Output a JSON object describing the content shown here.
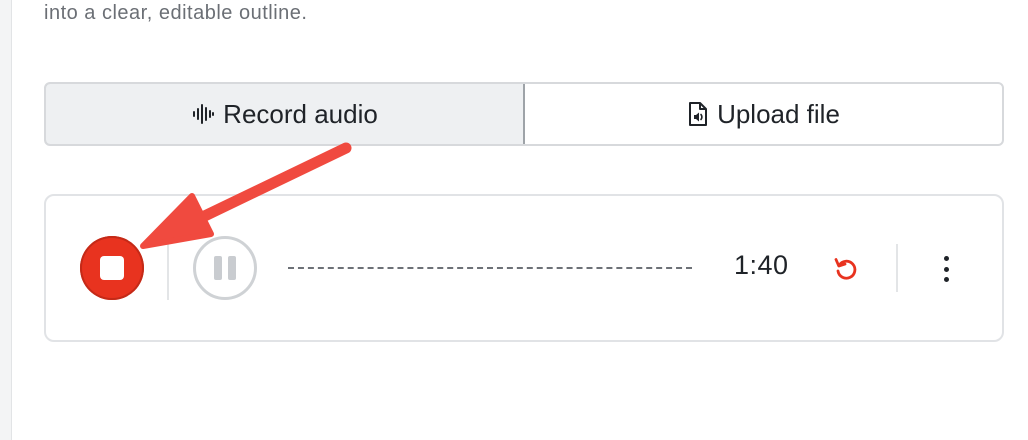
{
  "header": {
    "description_tail": "into a clear, editable outline."
  },
  "tabs": [
    {
      "label": "Record audio",
      "icon": "waveform-icon",
      "active": true
    },
    {
      "label": "Upload file",
      "icon": "audio-file-icon",
      "active": false
    }
  ],
  "recorder": {
    "elapsed": "1:40",
    "stop_icon": "stop-icon",
    "pause_icon": "pause-icon",
    "restart_icon": "restart-icon",
    "more_icon": "more-vertical-icon"
  },
  "colors": {
    "accent_red": "#e8331f",
    "annotation_arrow": "#f04a3f",
    "text": "#1f2328",
    "muted_text": "#6b6f75"
  }
}
